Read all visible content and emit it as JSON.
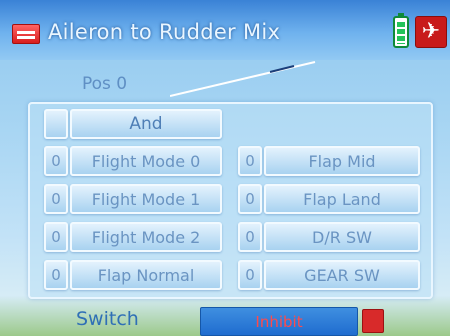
{
  "header": {
    "title": "Aileron to Rudder Mix"
  },
  "position": {
    "label": "Pos 0"
  },
  "logic": {
    "operator_slot": "",
    "operator": "And"
  },
  "conditions": {
    "left": [
      {
        "value": "0",
        "label": "Flight Mode 0"
      },
      {
        "value": "0",
        "label": "Flight Mode 1"
      },
      {
        "value": "0",
        "label": "Flight Mode 2"
      },
      {
        "value": "0",
        "label": "Flap Normal"
      }
    ],
    "right": [
      {
        "value": "0",
        "label": "Flap Mid"
      },
      {
        "value": "0",
        "label": "Flap Land"
      },
      {
        "value": "0",
        "label": "D/R SW"
      },
      {
        "value": "0",
        "label": "GEAR SW"
      }
    ]
  },
  "footer": {
    "switch_label": "Switch",
    "switch_value": "Inhibit"
  },
  "icons": {
    "title_icon": "model-menu-icon",
    "battery_icon": "battery-icon",
    "model_icon": "aircraft-model-icon",
    "switch_icon": "switch-indicator-icon"
  },
  "colors": {
    "accent": "#2f6fb6",
    "switch_value_bg": "#1f6ccf",
    "switch_value_text": "#ff4a4a",
    "battery": "#23c35a"
  }
}
